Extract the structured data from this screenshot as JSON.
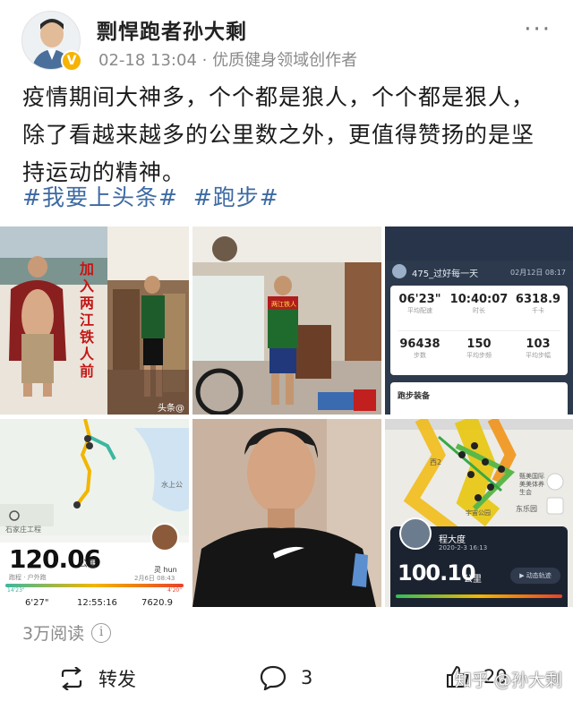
{
  "author": {
    "name": "剽悍跑者孙大剩",
    "badge": "V",
    "meta": "02-18 13:04 · 优质健身领域创作者"
  },
  "post": {
    "text": "疫情期间大神多，个个都是狼人，个个都是狠人，除了看越来越多的公里数之外，更值得赞扬的是坚持运动的精神。",
    "hashtags": [
      "#我要上头条#",
      "#跑步#"
    ]
  },
  "images": {
    "img1": {
      "caption": "加入两江铁人前",
      "watermark": "头条@"
    },
    "img2": {
      "banner": "两江铁人"
    },
    "img3": {
      "user": "475_过好每一天",
      "date": "02月12日 08:17",
      "stats_row1": [
        {
          "value": "06'23\"",
          "label": "平均配速"
        },
        {
          "value": "10:40:07",
          "label": "时长"
        },
        {
          "value": "6318.9",
          "label": "千卡"
        }
      ],
      "stats_row2": [
        {
          "value": "96438",
          "label": "步数"
        },
        {
          "value": "150",
          "label": "平均步频"
        },
        {
          "value": "103",
          "label": "平均步幅"
        }
      ],
      "section": "跑步装备"
    },
    "img4": {
      "distance": "120.06",
      "unit": "公里",
      "sub": "跑程 · 户外跑",
      "user": "灵 hun",
      "date": "2月6日 08:43",
      "map_label1": "石家庄工程",
      "map_label2": "水上公",
      "pace_min": "14'23\"",
      "pace_max": "4'20\"",
      "bottom": [
        "6'27\"",
        "12:55:16",
        "7620.9"
      ]
    },
    "img6": {
      "user": "程大度",
      "date": "2020-2-3 16:13",
      "distance": "100.10",
      "unit": "公里",
      "track_btn": "动态轨迹",
      "map_label1": "西2",
      "map_label2": "东乐园",
      "map_label3": "甄美国际美美体养生会",
      "map_label4": "宇宙公园"
    }
  },
  "reads": "3万阅读",
  "actions": {
    "forward": "转发",
    "comments": "3",
    "likes": "20"
  },
  "watermark": "知乎 @孙大剩"
}
